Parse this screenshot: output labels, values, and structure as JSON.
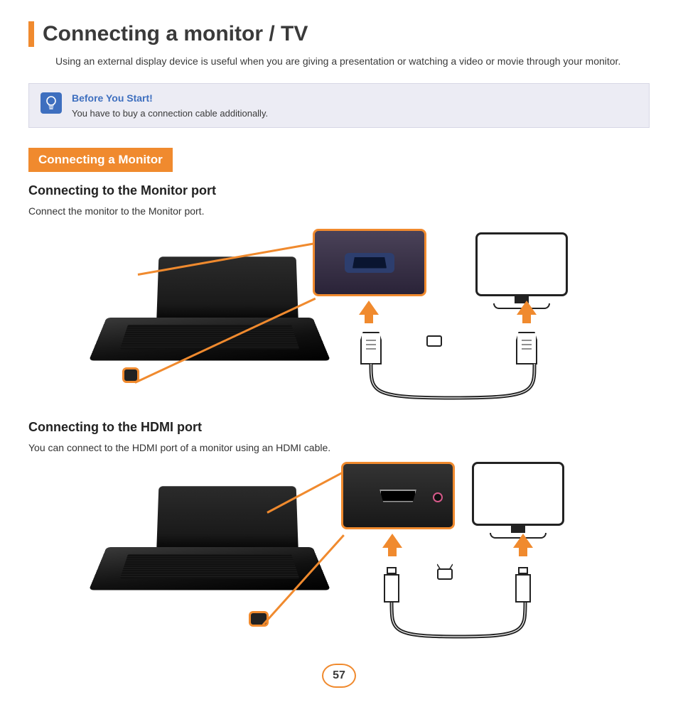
{
  "title": "Connecting a monitor / TV",
  "intro": "Using an external display device is useful when you are giving a presentation or watching a video or movie through your monitor.",
  "callout": {
    "title": "Before You Start!",
    "body": "You have to buy a connection cable additionally."
  },
  "section_tag": "Connecting a Monitor",
  "subsection1": {
    "heading": "Connecting to the Monitor port",
    "body": "Connect the monitor to the Monitor port."
  },
  "subsection2": {
    "heading": "Connecting to the HDMI port",
    "body": "You can connect to the HDMI port of a monitor using an HDMI cable."
  },
  "page_number": "57"
}
